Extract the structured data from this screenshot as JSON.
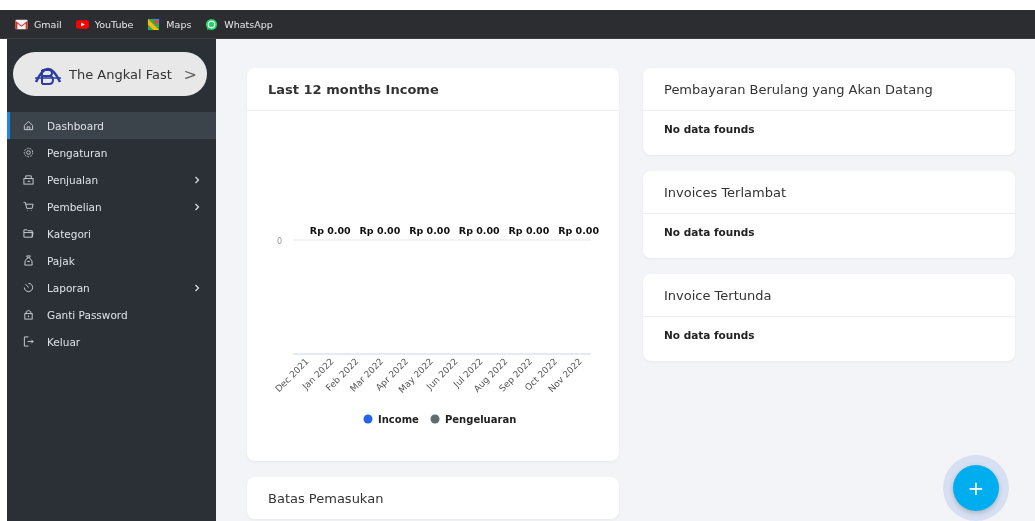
{
  "bookmarks": [
    {
      "kind": "gmail",
      "label": "Gmail"
    },
    {
      "kind": "youtube",
      "label": "YouTube"
    },
    {
      "kind": "maps",
      "label": "Maps"
    },
    {
      "kind": "whatsapp",
      "label": "WhatsApp"
    }
  ],
  "brand": {
    "name": "The Angkal Fast",
    "arrow": ">"
  },
  "sidebar": {
    "items": [
      {
        "label": "Dashboard",
        "selected": true,
        "submenu": false
      },
      {
        "label": "Pengaturan",
        "selected": false,
        "submenu": false
      },
      {
        "label": "Penjualan",
        "selected": false,
        "submenu": true
      },
      {
        "label": "Pembelian",
        "selected": false,
        "submenu": true
      },
      {
        "label": "Kategori",
        "selected": false,
        "submenu": false
      },
      {
        "label": "Pajak",
        "selected": false,
        "submenu": false
      },
      {
        "label": "Laporan",
        "selected": false,
        "submenu": true
      },
      {
        "label": "Ganti Password",
        "selected": false,
        "submenu": false
      },
      {
        "label": "Keluar",
        "selected": false,
        "submenu": false
      }
    ]
  },
  "income_card": {
    "title": "Last 12 months Income",
    "axis_zero_label": "0",
    "month_labels": [
      "Dec 2021",
      "Jan 2022",
      "Feb 2022",
      "Mar 2022",
      "Apr 2022",
      "May 2022",
      "Jun 2022",
      "Jul 2022",
      "Aug 2022",
      "Sep 2022",
      "Oct 2022",
      "Nov 2022"
    ],
    "amount_labels": [
      "Rp 0.00",
      "Rp 0.00",
      "Rp 0.00",
      "Rp 0.00",
      "Rp 0.00",
      "Rp 0.00"
    ],
    "legend": [
      {
        "name": "Income",
        "color": "#2463eb"
      },
      {
        "name": "Pengeluaran",
        "color": "#5f6b73"
      }
    ]
  },
  "limit_card": {
    "title": "Batas Pemasukan"
  },
  "side_cards": [
    {
      "title": "Pembayaran Berulang yang Akan Datang",
      "message": "No data founds"
    },
    {
      "title": "Invoices Terlambat",
      "message": "No data founds"
    },
    {
      "title": "Invoice Tertunda",
      "message": "No data founds"
    }
  ],
  "fab": {
    "label": "+"
  }
}
